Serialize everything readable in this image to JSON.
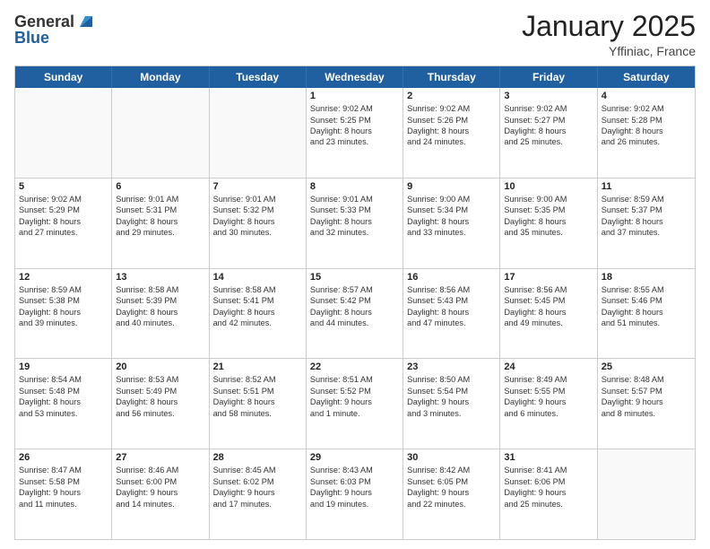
{
  "logo": {
    "general": "General",
    "blue": "Blue"
  },
  "header": {
    "month": "January 2025",
    "location": "Yffiniac, France"
  },
  "days_of_week": [
    "Sunday",
    "Monday",
    "Tuesday",
    "Wednesday",
    "Thursday",
    "Friday",
    "Saturday"
  ],
  "weeks": [
    [
      {
        "day": "",
        "lines": []
      },
      {
        "day": "",
        "lines": []
      },
      {
        "day": "",
        "lines": []
      },
      {
        "day": "1",
        "lines": [
          "Sunrise: 9:02 AM",
          "Sunset: 5:25 PM",
          "Daylight: 8 hours",
          "and 23 minutes."
        ]
      },
      {
        "day": "2",
        "lines": [
          "Sunrise: 9:02 AM",
          "Sunset: 5:26 PM",
          "Daylight: 8 hours",
          "and 24 minutes."
        ]
      },
      {
        "day": "3",
        "lines": [
          "Sunrise: 9:02 AM",
          "Sunset: 5:27 PM",
          "Daylight: 8 hours",
          "and 25 minutes."
        ]
      },
      {
        "day": "4",
        "lines": [
          "Sunrise: 9:02 AM",
          "Sunset: 5:28 PM",
          "Daylight: 8 hours",
          "and 26 minutes."
        ]
      }
    ],
    [
      {
        "day": "5",
        "lines": [
          "Sunrise: 9:02 AM",
          "Sunset: 5:29 PM",
          "Daylight: 8 hours",
          "and 27 minutes."
        ]
      },
      {
        "day": "6",
        "lines": [
          "Sunrise: 9:01 AM",
          "Sunset: 5:31 PM",
          "Daylight: 8 hours",
          "and 29 minutes."
        ]
      },
      {
        "day": "7",
        "lines": [
          "Sunrise: 9:01 AM",
          "Sunset: 5:32 PM",
          "Daylight: 8 hours",
          "and 30 minutes."
        ]
      },
      {
        "day": "8",
        "lines": [
          "Sunrise: 9:01 AM",
          "Sunset: 5:33 PM",
          "Daylight: 8 hours",
          "and 32 minutes."
        ]
      },
      {
        "day": "9",
        "lines": [
          "Sunrise: 9:00 AM",
          "Sunset: 5:34 PM",
          "Daylight: 8 hours",
          "and 33 minutes."
        ]
      },
      {
        "day": "10",
        "lines": [
          "Sunrise: 9:00 AM",
          "Sunset: 5:35 PM",
          "Daylight: 8 hours",
          "and 35 minutes."
        ]
      },
      {
        "day": "11",
        "lines": [
          "Sunrise: 8:59 AM",
          "Sunset: 5:37 PM",
          "Daylight: 8 hours",
          "and 37 minutes."
        ]
      }
    ],
    [
      {
        "day": "12",
        "lines": [
          "Sunrise: 8:59 AM",
          "Sunset: 5:38 PM",
          "Daylight: 8 hours",
          "and 39 minutes."
        ]
      },
      {
        "day": "13",
        "lines": [
          "Sunrise: 8:58 AM",
          "Sunset: 5:39 PM",
          "Daylight: 8 hours",
          "and 40 minutes."
        ]
      },
      {
        "day": "14",
        "lines": [
          "Sunrise: 8:58 AM",
          "Sunset: 5:41 PM",
          "Daylight: 8 hours",
          "and 42 minutes."
        ]
      },
      {
        "day": "15",
        "lines": [
          "Sunrise: 8:57 AM",
          "Sunset: 5:42 PM",
          "Daylight: 8 hours",
          "and 44 minutes."
        ]
      },
      {
        "day": "16",
        "lines": [
          "Sunrise: 8:56 AM",
          "Sunset: 5:43 PM",
          "Daylight: 8 hours",
          "and 47 minutes."
        ]
      },
      {
        "day": "17",
        "lines": [
          "Sunrise: 8:56 AM",
          "Sunset: 5:45 PM",
          "Daylight: 8 hours",
          "and 49 minutes."
        ]
      },
      {
        "day": "18",
        "lines": [
          "Sunrise: 8:55 AM",
          "Sunset: 5:46 PM",
          "Daylight: 8 hours",
          "and 51 minutes."
        ]
      }
    ],
    [
      {
        "day": "19",
        "lines": [
          "Sunrise: 8:54 AM",
          "Sunset: 5:48 PM",
          "Daylight: 8 hours",
          "and 53 minutes."
        ]
      },
      {
        "day": "20",
        "lines": [
          "Sunrise: 8:53 AM",
          "Sunset: 5:49 PM",
          "Daylight: 8 hours",
          "and 56 minutes."
        ]
      },
      {
        "day": "21",
        "lines": [
          "Sunrise: 8:52 AM",
          "Sunset: 5:51 PM",
          "Daylight: 8 hours",
          "and 58 minutes."
        ]
      },
      {
        "day": "22",
        "lines": [
          "Sunrise: 8:51 AM",
          "Sunset: 5:52 PM",
          "Daylight: 9 hours",
          "and 1 minute."
        ]
      },
      {
        "day": "23",
        "lines": [
          "Sunrise: 8:50 AM",
          "Sunset: 5:54 PM",
          "Daylight: 9 hours",
          "and 3 minutes."
        ]
      },
      {
        "day": "24",
        "lines": [
          "Sunrise: 8:49 AM",
          "Sunset: 5:55 PM",
          "Daylight: 9 hours",
          "and 6 minutes."
        ]
      },
      {
        "day": "25",
        "lines": [
          "Sunrise: 8:48 AM",
          "Sunset: 5:57 PM",
          "Daylight: 9 hours",
          "and 8 minutes."
        ]
      }
    ],
    [
      {
        "day": "26",
        "lines": [
          "Sunrise: 8:47 AM",
          "Sunset: 5:58 PM",
          "Daylight: 9 hours",
          "and 11 minutes."
        ]
      },
      {
        "day": "27",
        "lines": [
          "Sunrise: 8:46 AM",
          "Sunset: 6:00 PM",
          "Daylight: 9 hours",
          "and 14 minutes."
        ]
      },
      {
        "day": "28",
        "lines": [
          "Sunrise: 8:45 AM",
          "Sunset: 6:02 PM",
          "Daylight: 9 hours",
          "and 17 minutes."
        ]
      },
      {
        "day": "29",
        "lines": [
          "Sunrise: 8:43 AM",
          "Sunset: 6:03 PM",
          "Daylight: 9 hours",
          "and 19 minutes."
        ]
      },
      {
        "day": "30",
        "lines": [
          "Sunrise: 8:42 AM",
          "Sunset: 6:05 PM",
          "Daylight: 9 hours",
          "and 22 minutes."
        ]
      },
      {
        "day": "31",
        "lines": [
          "Sunrise: 8:41 AM",
          "Sunset: 6:06 PM",
          "Daylight: 9 hours",
          "and 25 minutes."
        ]
      },
      {
        "day": "",
        "lines": []
      }
    ]
  ]
}
